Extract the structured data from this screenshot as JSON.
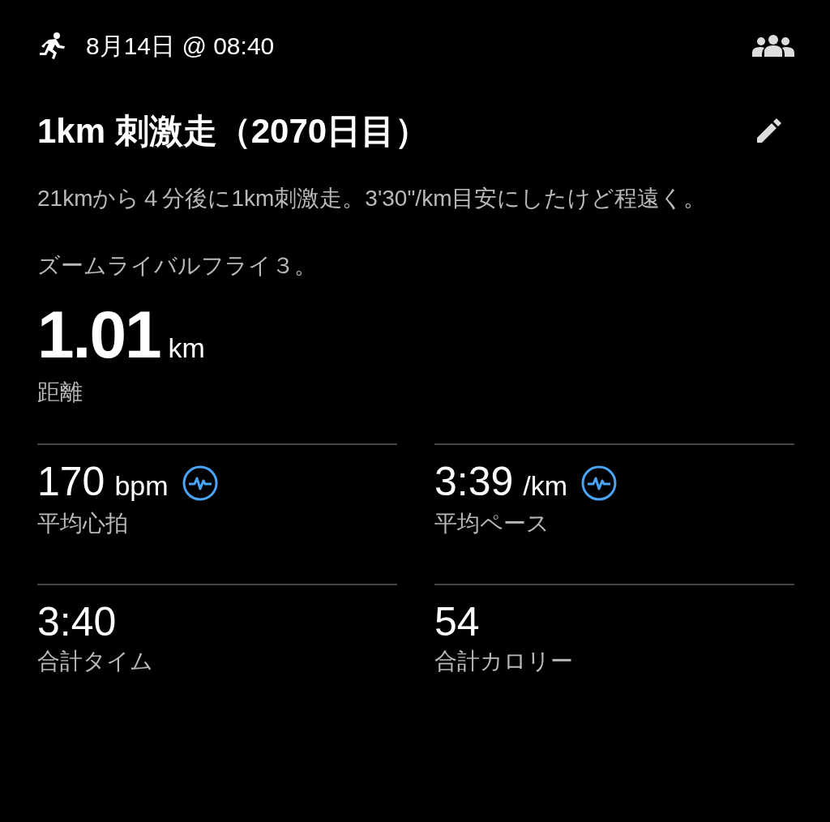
{
  "header": {
    "date": "8月14日 @ 08:40"
  },
  "title": "1km 刺激走（2070日目）",
  "description": [
    "21kmから４分後に1km刺激走。3'30\"/km目安にしたけど程遠く。",
    "ズームライバルフライ３。"
  ],
  "distance": {
    "value": "1.01",
    "unit": "km",
    "label": "距離"
  },
  "stats": [
    {
      "value": "170",
      "unit": "bpm",
      "label": "平均心拍",
      "kind": "sensor"
    },
    {
      "value": "3:39",
      "unit": "/km",
      "label": "平均ペース",
      "kind": "sensor"
    },
    {
      "value": "3:40",
      "label": "合計タイム",
      "kind": "plain"
    },
    {
      "value": "54",
      "label": "合計カロリー",
      "kind": "plain"
    }
  ]
}
